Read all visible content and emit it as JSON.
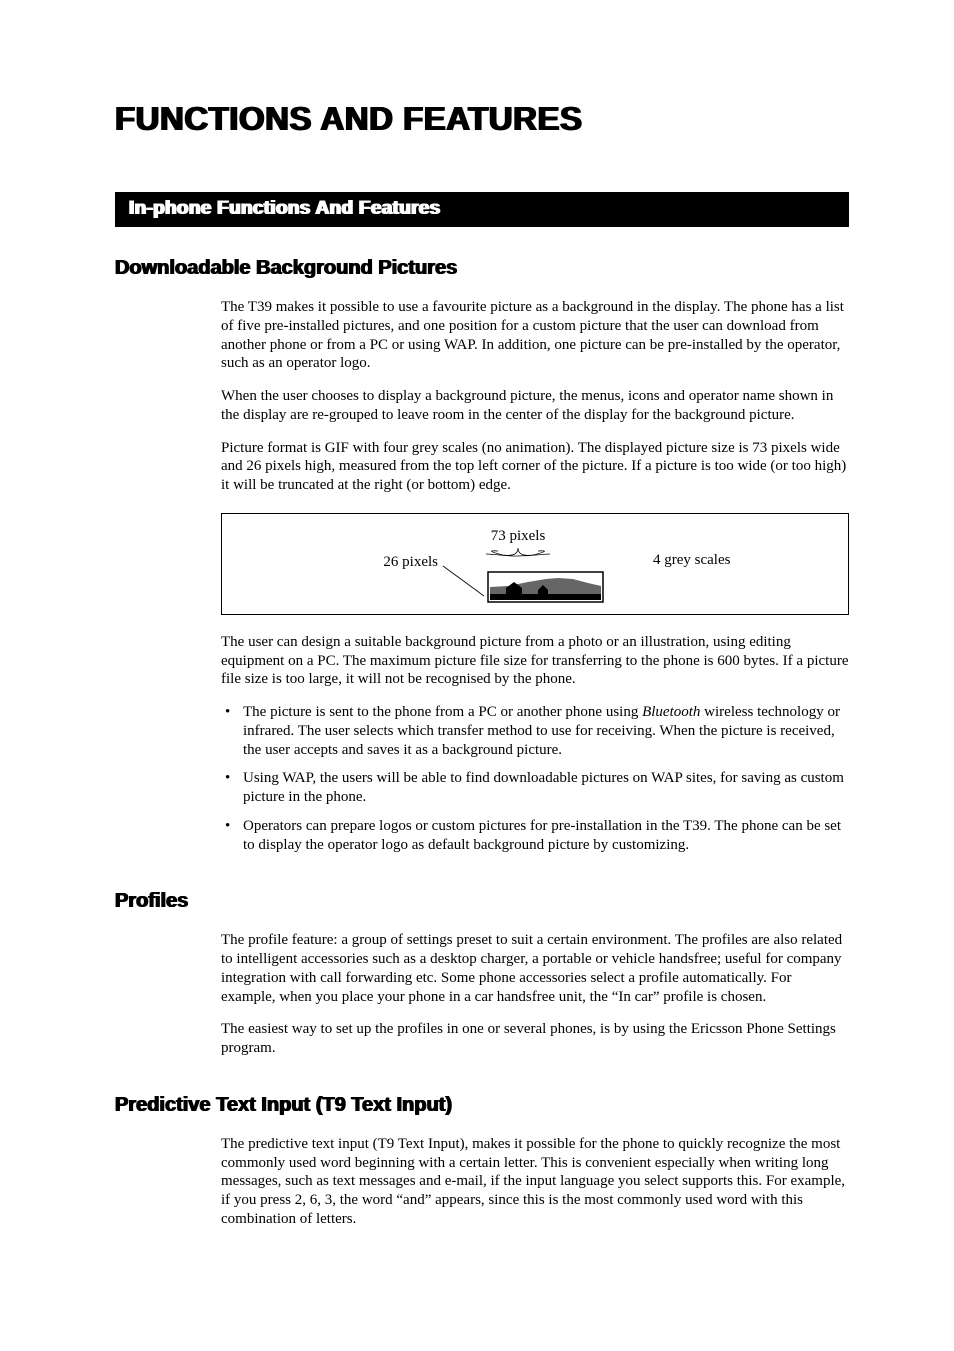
{
  "title": "FUNCTIONS AND FEATURES",
  "sectionBar": "In-phone Functions And Features",
  "sub1": {
    "heading": "Downloadable Background Pictures",
    "p1": "The T39 makes it possible to use a favourite picture as a background in the display. The phone has a list of five pre-installed pictures, and one position for a custom picture that the user can download from another phone or from a PC or using WAP. In addition, one picture can be pre-installed by the operator, such as an operator logo.",
    "p2": "When the user chooses to display a background picture, the menus, icons and operator name shown in the display are re-grouped to leave room in the center of the display for the background picture.",
    "p3": "Picture format is GIF with four grey scales (no animation). The displayed picture size is 73 pixels wide and 26 pixels high, measured from the top left corner of the picture. If a picture is too wide (or too high) it will be truncated at the right (or bottom) edge.",
    "figure": {
      "label_width": "73 pixels",
      "label_height": "26 pixels",
      "label_grey": "4 grey scales"
    },
    "p4": "The user can design a suitable background picture from a photo or an illustration, using editing equipment on a PC. The maximum picture file size for transferring to the phone is 600 bytes. If a picture file size is too large, it will not be recognised by the phone.",
    "bullets": [
      {
        "prefix": "The picture is sent to the phone from a PC or another phone using ",
        "em": "Bluetooth",
        "suffix": " wireless technology or infrared. The user selects which transfer method to use for receiving. When the picture is received, the user accepts and saves it as a background picture."
      },
      {
        "prefix": "Using WAP, the users will be able to find downloadable pictures on WAP sites, for saving as custom picture in the phone.",
        "em": "",
        "suffix": ""
      },
      {
        "prefix": "Operators can prepare logos or custom pictures for pre-installation in the T39. The phone can be set to display the operator logo as default background picture by customizing.",
        "em": "",
        "suffix": ""
      }
    ]
  },
  "sub2": {
    "heading": "Profiles",
    "p1": "The profile feature: a group of settings preset to suit a certain environment. The profiles are also related to intelligent accessories such as a desktop charger, a portable or vehicle handsfree; useful for company integration with call forwarding etc. Some phone accessories select a profile automatically. For example, when you place your phone in a car handsfree unit, the “In car” profile is chosen.",
    "p2": "The easiest way to set up the profiles in one or several phones, is by using the Ericsson Phone Settings program."
  },
  "sub3": {
    "heading": "Predictive Text Input (T9 Text Input)",
    "p1": "The predictive text input (T9 Text Input), makes it possible for the phone to quickly recognize the most commonly used word beginning with a certain letter. This is convenient especially when writing long messages, such as text messages and e-mail, if the input language you select supports this. For example, if you press 2, 6, 3, the word “and” appears, since this is the most commonly used word with this combination of letters."
  }
}
